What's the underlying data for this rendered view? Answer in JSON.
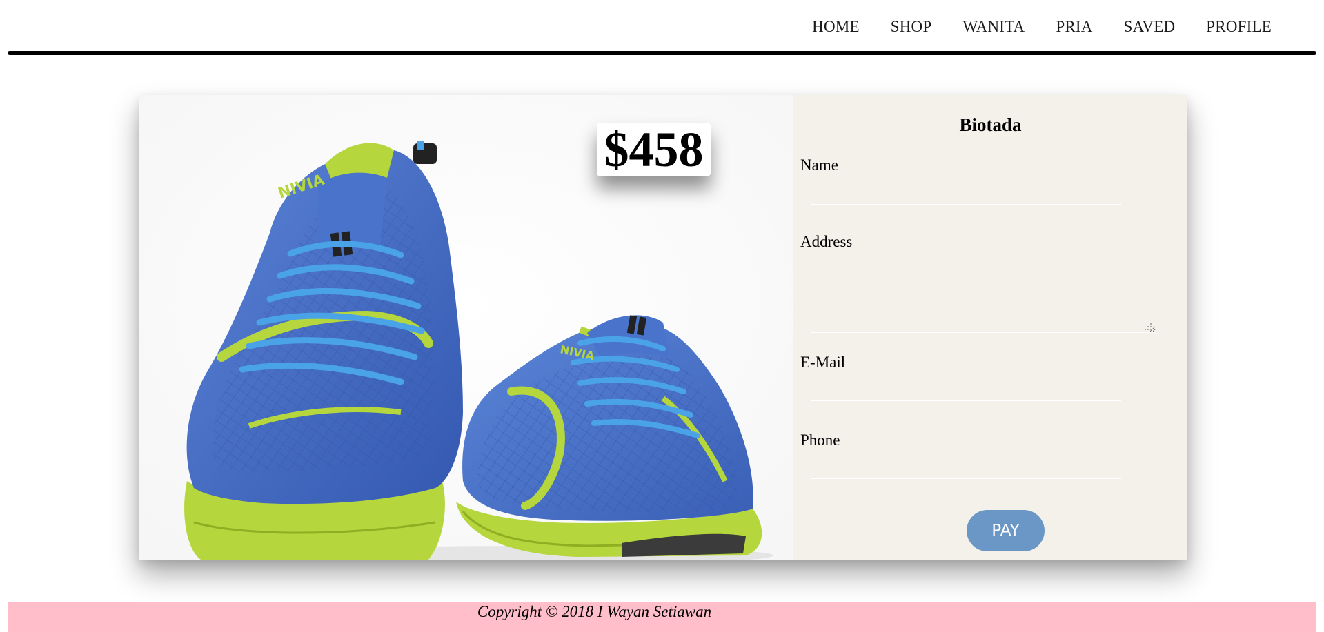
{
  "nav": {
    "items": [
      {
        "label": "HOME"
      },
      {
        "label": "SHOP"
      },
      {
        "label": "WANITA"
      },
      {
        "label": "PRIA"
      },
      {
        "label": "SAVED"
      },
      {
        "label": "PROFILE"
      }
    ]
  },
  "product": {
    "price": "$458",
    "image_alt_icon": "blue-green-sneakers-image",
    "brand_on_shoe": "NIVIA"
  },
  "form": {
    "title": "Biotada",
    "name_label": "Name",
    "address_label": "Address",
    "email_label": "E-Mail",
    "phone_label": "Phone",
    "name_value": "",
    "address_value": "",
    "email_value": "",
    "phone_value": "",
    "pay_label": "PAY"
  },
  "footer": {
    "copyright": "Copyright © 2018 I Wayan Setiawan"
  },
  "colors": {
    "form_background": "#f4f0ea",
    "pay_button": "#6b97c6",
    "footer_background": "#ffbec9",
    "nav_rule": "#000000"
  }
}
